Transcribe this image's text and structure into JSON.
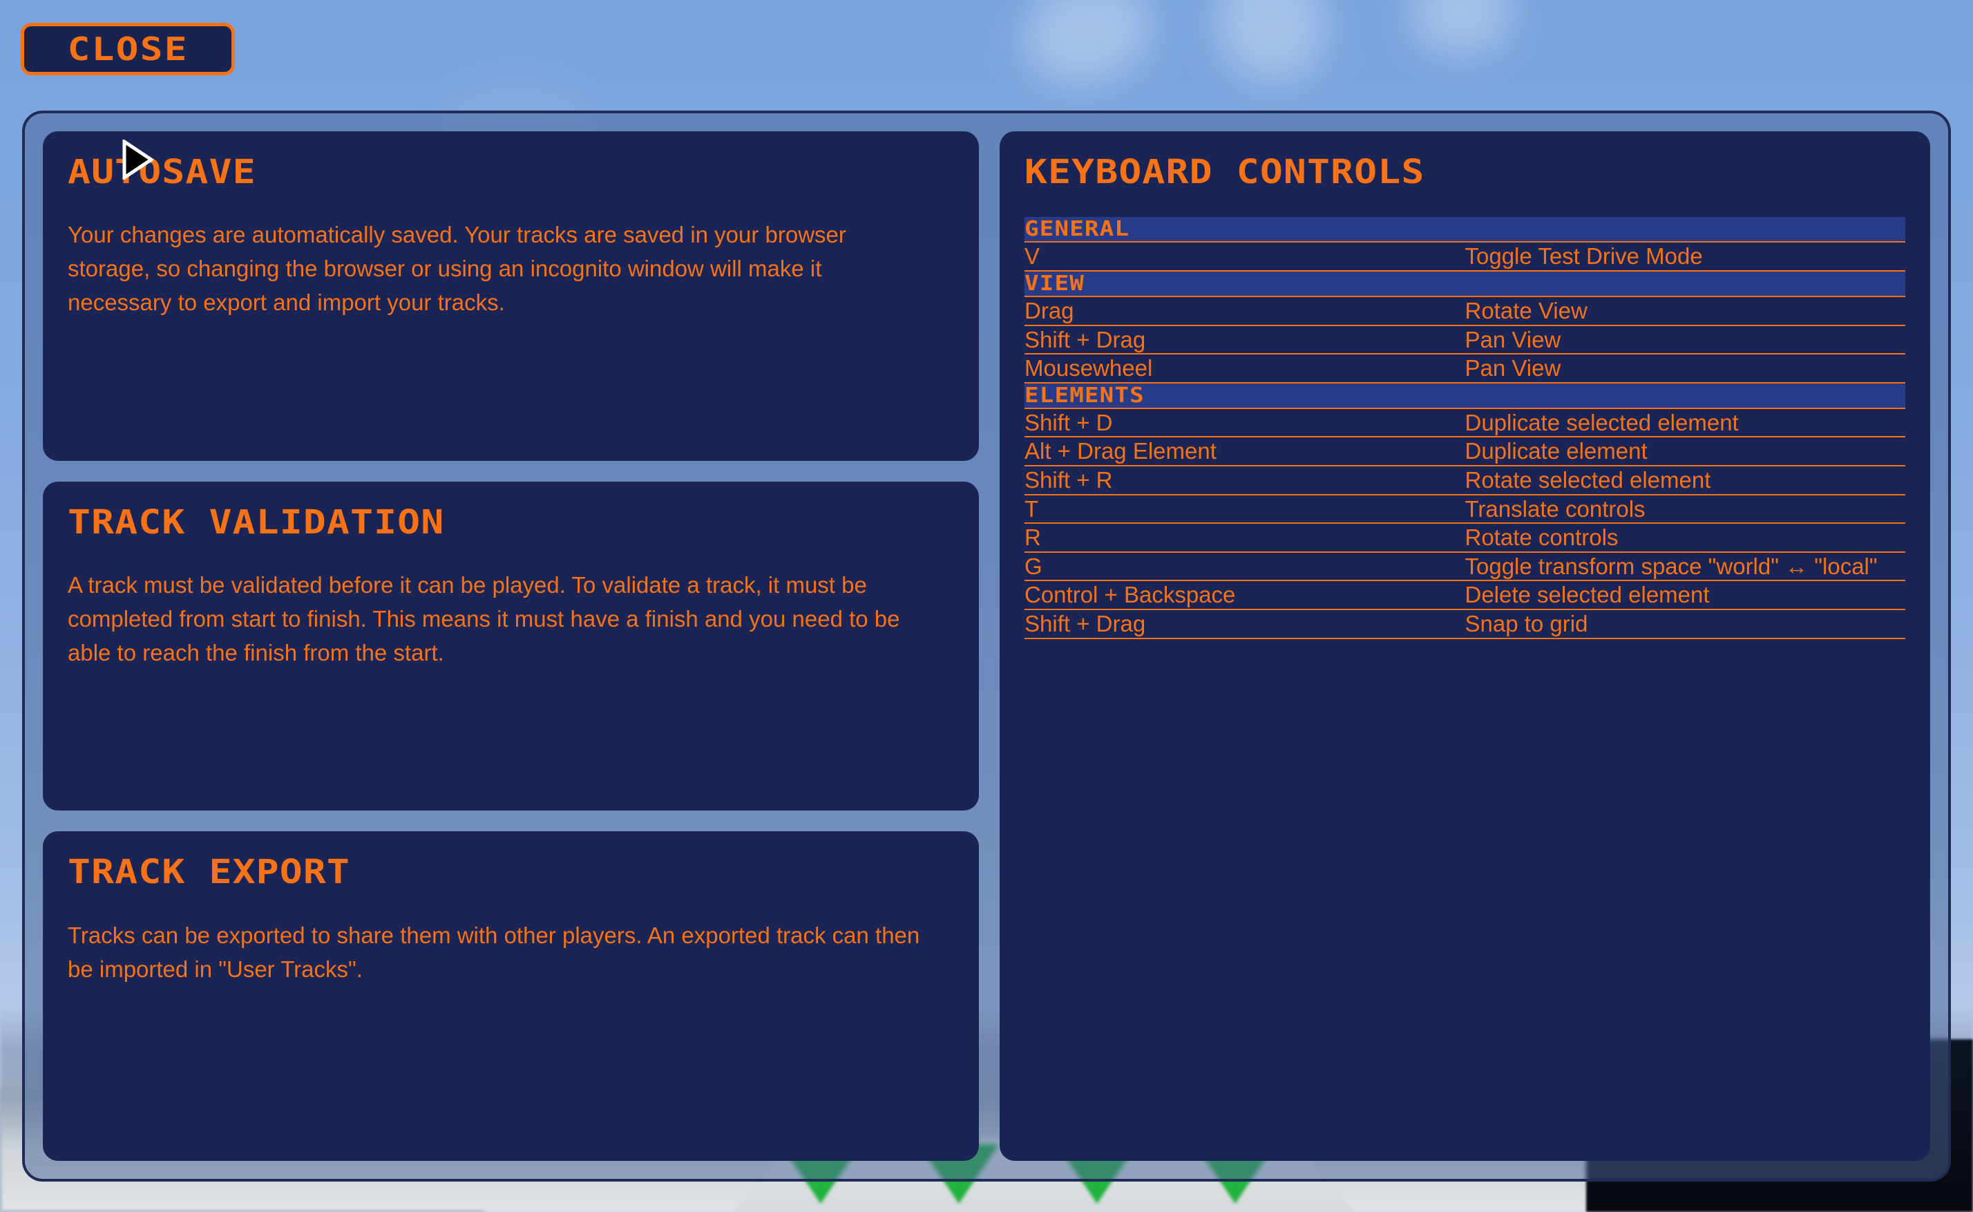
{
  "close_button": {
    "label": "CLOSE"
  },
  "panels": [
    {
      "title": "AUTOSAVE",
      "body": "Your changes are automatically saved. Your tracks are saved in your browser storage, so changing the browser or using an incognito window will make it necessary to export and import your tracks."
    },
    {
      "title": "TRACK VALIDATION",
      "body": "A track must be validated before it can be played. To validate a track, it must be completed from start to finish. This means it must have a finish and you need to be able to reach the finish from the start."
    },
    {
      "title": "TRACK EXPORT",
      "body": "Tracks can be exported to share them with other players. An exported track can then be imported in \"User Tracks\"."
    }
  ],
  "controls": {
    "title": "KEYBOARD CONTROLS",
    "sections": [
      {
        "name": "GENERAL",
        "rows": [
          {
            "key": "V",
            "desc": "Toggle Test Drive Mode"
          }
        ]
      },
      {
        "name": "VIEW",
        "rows": [
          {
            "key": "Drag",
            "desc": "Rotate View"
          },
          {
            "key": "Shift + Drag",
            "desc": "Pan View"
          },
          {
            "key": "Mousewheel",
            "desc": "Pan View"
          }
        ]
      },
      {
        "name": "ELEMENTS",
        "rows": [
          {
            "key": "Shift + D",
            "desc": "Duplicate selected element"
          },
          {
            "key": "Alt + Drag Element",
            "desc": "Duplicate element"
          },
          {
            "key": "Shift + R",
            "desc": "Rotate selected element"
          },
          {
            "key": "T",
            "desc": "Translate controls"
          },
          {
            "key": "R",
            "desc": "Rotate controls"
          },
          {
            "key": "G",
            "desc": "Toggle transform space \"world\" ↔ \"local\""
          },
          {
            "key": "Control + Backspace",
            "desc": "Delete selected element"
          },
          {
            "key": "Shift + Drag",
            "desc": "Snap to grid"
          }
        ]
      }
    ]
  },
  "colors": {
    "accent": "#f97316",
    "card_bg": "#1a2455",
    "section_bg": "#273b89",
    "overlay_border": "#202c56"
  }
}
